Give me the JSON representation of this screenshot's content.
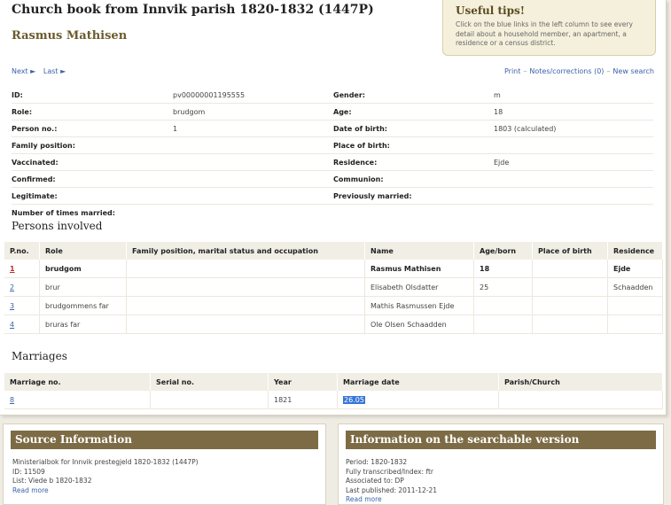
{
  "header": {
    "title": "Church book from Innvik parish 1820-1832 (1447P)",
    "person_name": "Rasmus Mathisen"
  },
  "tips": {
    "title": "Useful tips!",
    "text": "Click on the blue links in the left column to see every detail about a household member, an apartment, a residence or a census district."
  },
  "nav": {
    "next": "Next ►",
    "last": "Last ►"
  },
  "tools": {
    "print": "Print",
    "notes": "Notes/corrections (0)",
    "new_search": "New search",
    "sep": "–"
  },
  "info_rows": [
    {
      "l1": "ID:",
      "v1": "pv00000001195555",
      "l2": "Gender:",
      "v2": "m"
    },
    {
      "l1": "Role:",
      "v1": "brudgom",
      "l2": "Age:",
      "v2": "18"
    },
    {
      "l1": "Person no.:",
      "v1": "1",
      "l2": "Date of birth:",
      "v2": "1803 (calculated)"
    },
    {
      "l1": "Family position:",
      "v1": "",
      "l2": "Place of birth:",
      "v2": ""
    },
    {
      "l1": "Vaccinated:",
      "v1": "",
      "l2": "Residence:",
      "v2": "Ejde"
    },
    {
      "l1": "Confirmed:",
      "v1": "",
      "l2": "Communion:",
      "v2": ""
    },
    {
      "l1": "Legitimate:",
      "v1": "",
      "l2": "Previously married:",
      "v2": ""
    },
    {
      "l1": "Number of times married:",
      "v1": "",
      "l2": "",
      "v2": ""
    }
  ],
  "persons": {
    "heading": "Persons involved",
    "columns": [
      "P.no.",
      "Role",
      "Family position, marital status and occupation",
      "Name",
      "Age/born",
      "Place of birth",
      "Residence"
    ],
    "rows": [
      {
        "pno": "1",
        "role": "brudgom",
        "family": "",
        "name": "Rasmus Mathisen",
        "age": "18",
        "birthplace": "",
        "residence": "Ejde"
      },
      {
        "pno": "2",
        "role": "brur",
        "family": "",
        "name": "Elisabeth Olsdatter",
        "age": "25",
        "birthplace": "",
        "residence": "Schaadden"
      },
      {
        "pno": "3",
        "role": "brudgommens far",
        "family": "",
        "name": "Mathis Rasmussen Ejde",
        "age": "",
        "birthplace": "",
        "residence": ""
      },
      {
        "pno": "4",
        "role": "bruras far",
        "family": "",
        "name": "Ole Olsen Schaadden",
        "age": "",
        "birthplace": "",
        "residence": ""
      }
    ]
  },
  "marriages": {
    "heading": "Marriages",
    "columns": [
      "Marriage no.",
      "Serial no.",
      "Year",
      "Marriage date",
      "Parish/Church"
    ],
    "rows": [
      {
        "no": "8",
        "serial": "",
        "year": "1821",
        "date": "26.05",
        "parish": ""
      }
    ]
  },
  "source": {
    "heading": "Source Information",
    "lines": [
      "Ministerialbok for Innvik prestegjeld 1820-1832 (1447P)",
      "ID: 11509",
      "List: Viede b 1820-1832"
    ],
    "read_more": "Read more"
  },
  "searchable": {
    "heading": "Information on the searchable version",
    "lines": [
      "Period: 1820-1832",
      "Fully transcribed/Index: ftr",
      "Associated to: DP",
      "Last published: 2011-12-21"
    ],
    "read_more": "Read more"
  }
}
